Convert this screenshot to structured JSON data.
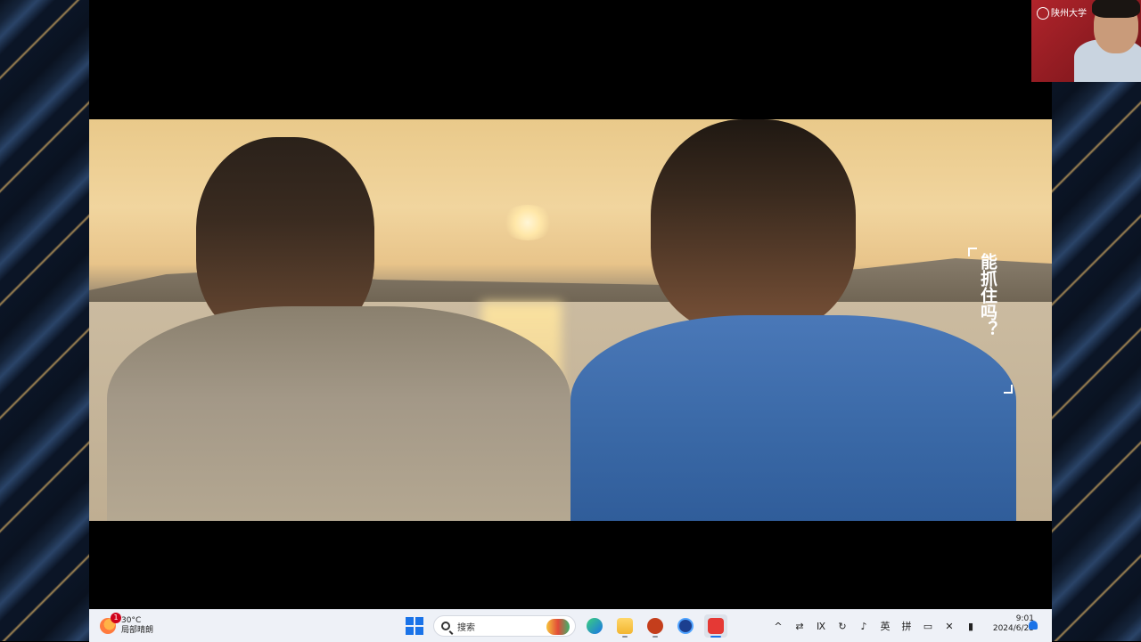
{
  "video": {
    "subtitle_chars": "能抓住吗？"
  },
  "webcam": {
    "overlay_logo_text": "陕州大学"
  },
  "taskbar": {
    "weather": {
      "badge_count": "1",
      "temperature": "30°C",
      "condition": "局部晴朗"
    },
    "search": {
      "placeholder": "搜索"
    },
    "pinned_apps": [
      "start-icon",
      "edge-icon",
      "file-explorer-icon",
      "powerpoint-icon",
      "app-icon",
      "screen-recorder-icon"
    ],
    "tray": {
      "ime_lang": "英",
      "ime_mode": "拼"
    },
    "clock": {
      "time": "9:01",
      "date": "2024/6/23"
    }
  },
  "colors": {
    "taskbar_bg": "#eef1f7",
    "accent": "#1a73e8",
    "video_sky": "#f1d59e",
    "shirt_blue": "#3b6aa8"
  }
}
